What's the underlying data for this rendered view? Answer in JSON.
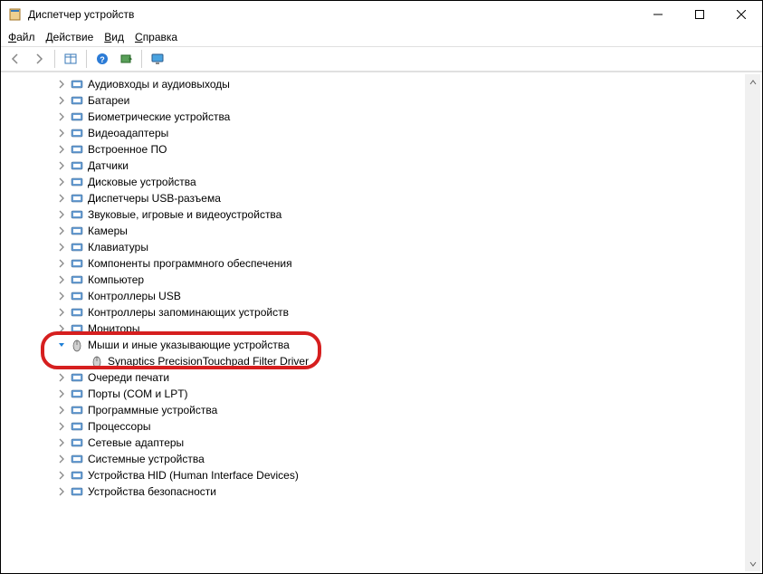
{
  "window": {
    "title": "Диспетчер устройств"
  },
  "menubar": {
    "file": "Файл",
    "action": "Действие",
    "view": "Вид",
    "help": "Справка"
  },
  "tree": {
    "nodes": [
      {
        "label": "Аудиовходы и аудиовыходы",
        "icon": "audio",
        "expanded": false
      },
      {
        "label": "Батареи",
        "icon": "battery",
        "expanded": false
      },
      {
        "label": "Биометрические устройства",
        "icon": "biometric",
        "expanded": false
      },
      {
        "label": "Видеоадаптеры",
        "icon": "display",
        "expanded": false
      },
      {
        "label": "Встроенное ПО",
        "icon": "firmware",
        "expanded": false
      },
      {
        "label": "Датчики",
        "icon": "sensor",
        "expanded": false
      },
      {
        "label": "Дисковые устройства",
        "icon": "disk",
        "expanded": false
      },
      {
        "label": "Диспетчеры USB-разъема",
        "icon": "usb",
        "expanded": false
      },
      {
        "label": "Звуковые, игровые и видеоустройства",
        "icon": "sound",
        "expanded": false
      },
      {
        "label": "Камеры",
        "icon": "camera",
        "expanded": false
      },
      {
        "label": "Клавиатуры",
        "icon": "keyboard",
        "expanded": false
      },
      {
        "label": "Компоненты программного обеспечения",
        "icon": "software",
        "expanded": false
      },
      {
        "label": "Компьютер",
        "icon": "computer",
        "expanded": false
      },
      {
        "label": "Контроллеры USB",
        "icon": "usbctrl",
        "expanded": false
      },
      {
        "label": "Контроллеры запоминающих устройств",
        "icon": "storage",
        "expanded": false
      },
      {
        "label": "Мониторы",
        "icon": "monitor",
        "expanded": false
      },
      {
        "label": "Мыши и иные указывающие устройства",
        "icon": "mouse",
        "expanded": true,
        "children": [
          {
            "label": "Synaptics PrecisionTouchpad Filter Driver",
            "icon": "mouse"
          }
        ]
      },
      {
        "label": "Очереди печати",
        "icon": "printer",
        "expanded": false
      },
      {
        "label": "Порты (COM и LPT)",
        "icon": "port",
        "expanded": false
      },
      {
        "label": "Программные устройства",
        "icon": "software",
        "expanded": false
      },
      {
        "label": "Процессоры",
        "icon": "cpu",
        "expanded": false
      },
      {
        "label": "Сетевые адаптеры",
        "icon": "network",
        "expanded": false
      },
      {
        "label": "Системные устройства",
        "icon": "system",
        "expanded": false
      },
      {
        "label": "Устройства HID (Human Interface Devices)",
        "icon": "hid",
        "expanded": false
      },
      {
        "label": "Устройства безопасности",
        "icon": "security",
        "expanded": false
      }
    ]
  },
  "highlight": {
    "node_index": 16
  },
  "colors": {
    "highlight_border": "#d61f1f",
    "expanded_chevron": "#1e7fd6"
  }
}
